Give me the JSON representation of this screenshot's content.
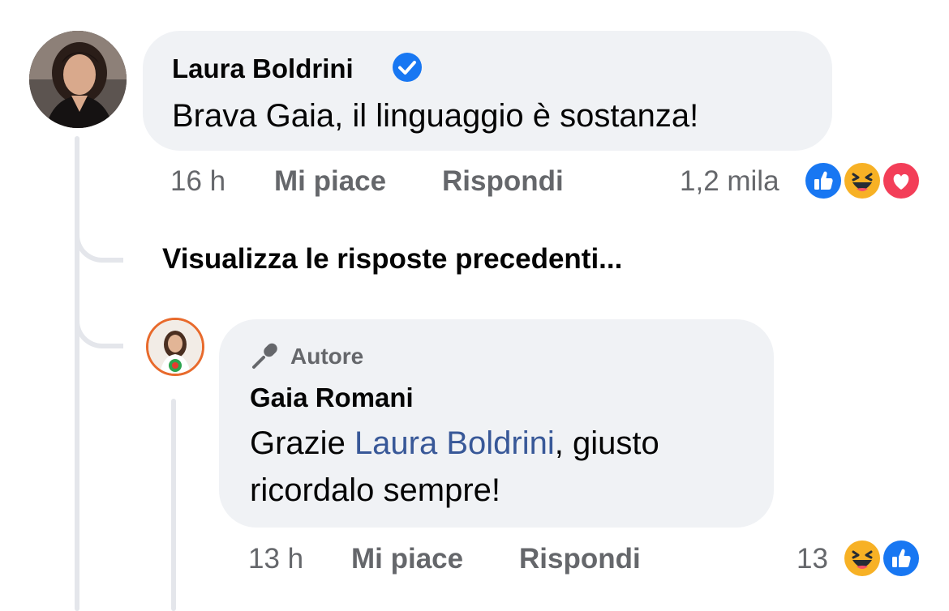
{
  "comments": [
    {
      "author": "Laura Boldrini",
      "verified": true,
      "text": "Brava Gaia, il linguaggio è sostanza!",
      "time": "16 h",
      "like_label": "Mi piace",
      "reply_label": "Rispondi",
      "reaction_count": "1,2 mila",
      "reactions": [
        "like-icon",
        "haha-icon",
        "love-icon"
      ]
    }
  ],
  "view_previous_label": "Visualizza le risposte precedenti...",
  "reply": {
    "badge_label": "Autore",
    "author": "Gaia Romani",
    "text_before": "Grazie ",
    "mention": "Laura Boldrini",
    "text_after": ", giusto ricordalo sempre!",
    "time": "13 h",
    "like_label": "Mi piace",
    "reply_label": "Rispondi",
    "reaction_count": "13",
    "reactions": [
      "haha-icon",
      "like-icon"
    ]
  },
  "colors": {
    "bubble": "#f0f2f5",
    "meta_text": "#65676b",
    "mention": "#385898",
    "like_blue": "#1877f2",
    "love_red": "#f33e58",
    "haha_yellow": "#f7b125",
    "thread_line": "#e4e6eb"
  }
}
